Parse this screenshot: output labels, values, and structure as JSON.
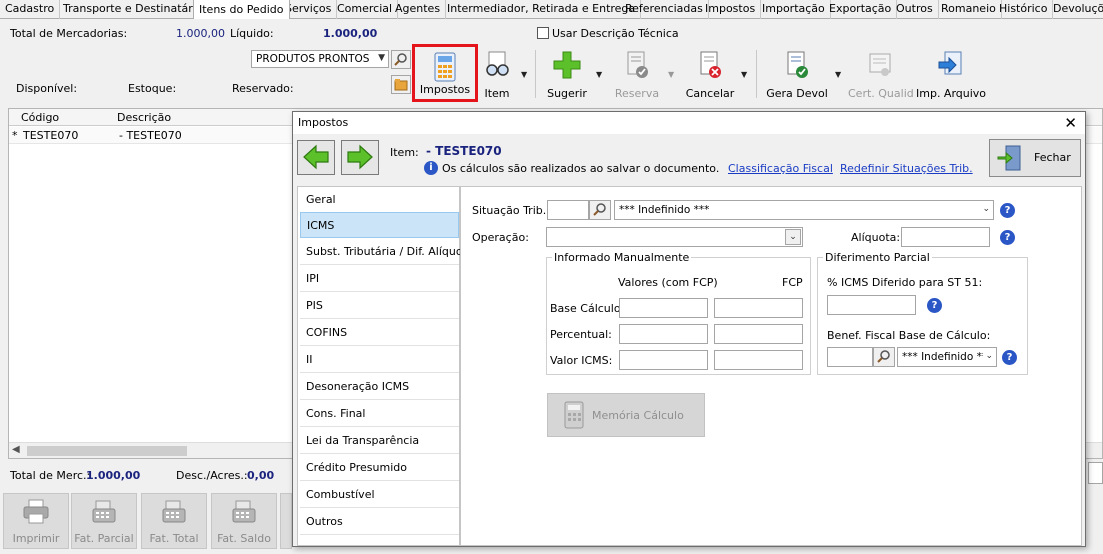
{
  "tabs": [
    "Cadastro",
    "Transporte e Destinatário",
    "Itens do Pedido",
    "Serviços",
    "Comercial",
    "Agentes",
    "Intermediador, Retirada e Entrega",
    "Referenciadas",
    "Impostos",
    "Importação",
    "Exportação",
    "Outros",
    "Romaneio",
    "Histórico",
    "Devoluções"
  ],
  "active_tab": "Itens do Pedido",
  "summary": {
    "total_mercadorias_label": "Total de Mercadorias:",
    "total_mercadorias_value": "1.000,00",
    "liquido_label": "Líquido:",
    "liquido_value": "1.000,00",
    "usar_descricao_label": "Usar Descrição Técnica"
  },
  "stock": {
    "product_type": "PRODUTOS PRONTOS",
    "disponivel_label": "Disponível:",
    "estoque_label": "Estoque:",
    "reservado_label": "Reservado:"
  },
  "toolbar": {
    "impostos": "Impostos",
    "item": "Item",
    "sugerir": "Sugerir",
    "reserva": "Reserva",
    "cancelar": "Cancelar",
    "gera_devol": "Gera Devol",
    "cert_qualid": "Cert. Qualid",
    "imp_arquivo": "Imp. Arquivo"
  },
  "grid": {
    "col_codigo": "Código",
    "col_descricao": "Descrição",
    "row_marker": "*",
    "row_codigo": "TESTE070",
    "row_descricao": "- TESTE070"
  },
  "footer": {
    "total_merc_label": "Total de Merc.:",
    "total_merc_value": "1.000,00",
    "desc_acres_label": "Desc./Acres.:",
    "desc_acres_value": "0,00"
  },
  "bottom_buttons": [
    "Imprimir",
    "Fat. Parcial",
    "Fat. Total",
    "Fat. Saldo"
  ],
  "modal": {
    "title": "Impostos",
    "item_label": "Item:",
    "item_value": "- TESTE070",
    "info_text": "Os cálculos são realizados ao salvar o documento.",
    "link_classificacao": "Classificação Fiscal",
    "link_redefinir": "Redefinir Situações Trib.",
    "fechar": "Fechar",
    "left_items": [
      "Geral",
      "ICMS",
      "Subst. Tributária / Dif. Alíquota",
      "IPI",
      "PIS",
      "COFINS",
      "II",
      "Desoneração ICMS",
      "Cons. Final",
      "Lei da Transparência",
      "Crédito Presumido",
      "Combustível",
      "Outros"
    ],
    "selected_item": "ICMS",
    "situacao_label": "Situação Trib.:",
    "situacao_value": "*** Indefinido ***",
    "operacao_label": "Operação:",
    "aliquota_label": "Alíquota:",
    "informado_title": "Informado Manualmente",
    "valores_label": "Valores (com FCP)",
    "fcp_label": "FCP",
    "base_calculo_label": "Base Cálculo:",
    "percentual_label": "Percentual:",
    "valor_icms_label": "Valor ICMS:",
    "diferimento_title": "Diferimento Parcial",
    "icms_diferido_label": "% ICMS Diferido para ST 51:",
    "benef_label": "Benef. Fiscal Base de Cálculo:",
    "benef_value": "*** Indefinido ***",
    "memoria_button": "Memória Cálculo"
  },
  "colors": {
    "accent_blue": "#1a237e",
    "highlight_red": "#e5141a",
    "selection": "#cce4f7",
    "link": "#1a3cc4"
  }
}
